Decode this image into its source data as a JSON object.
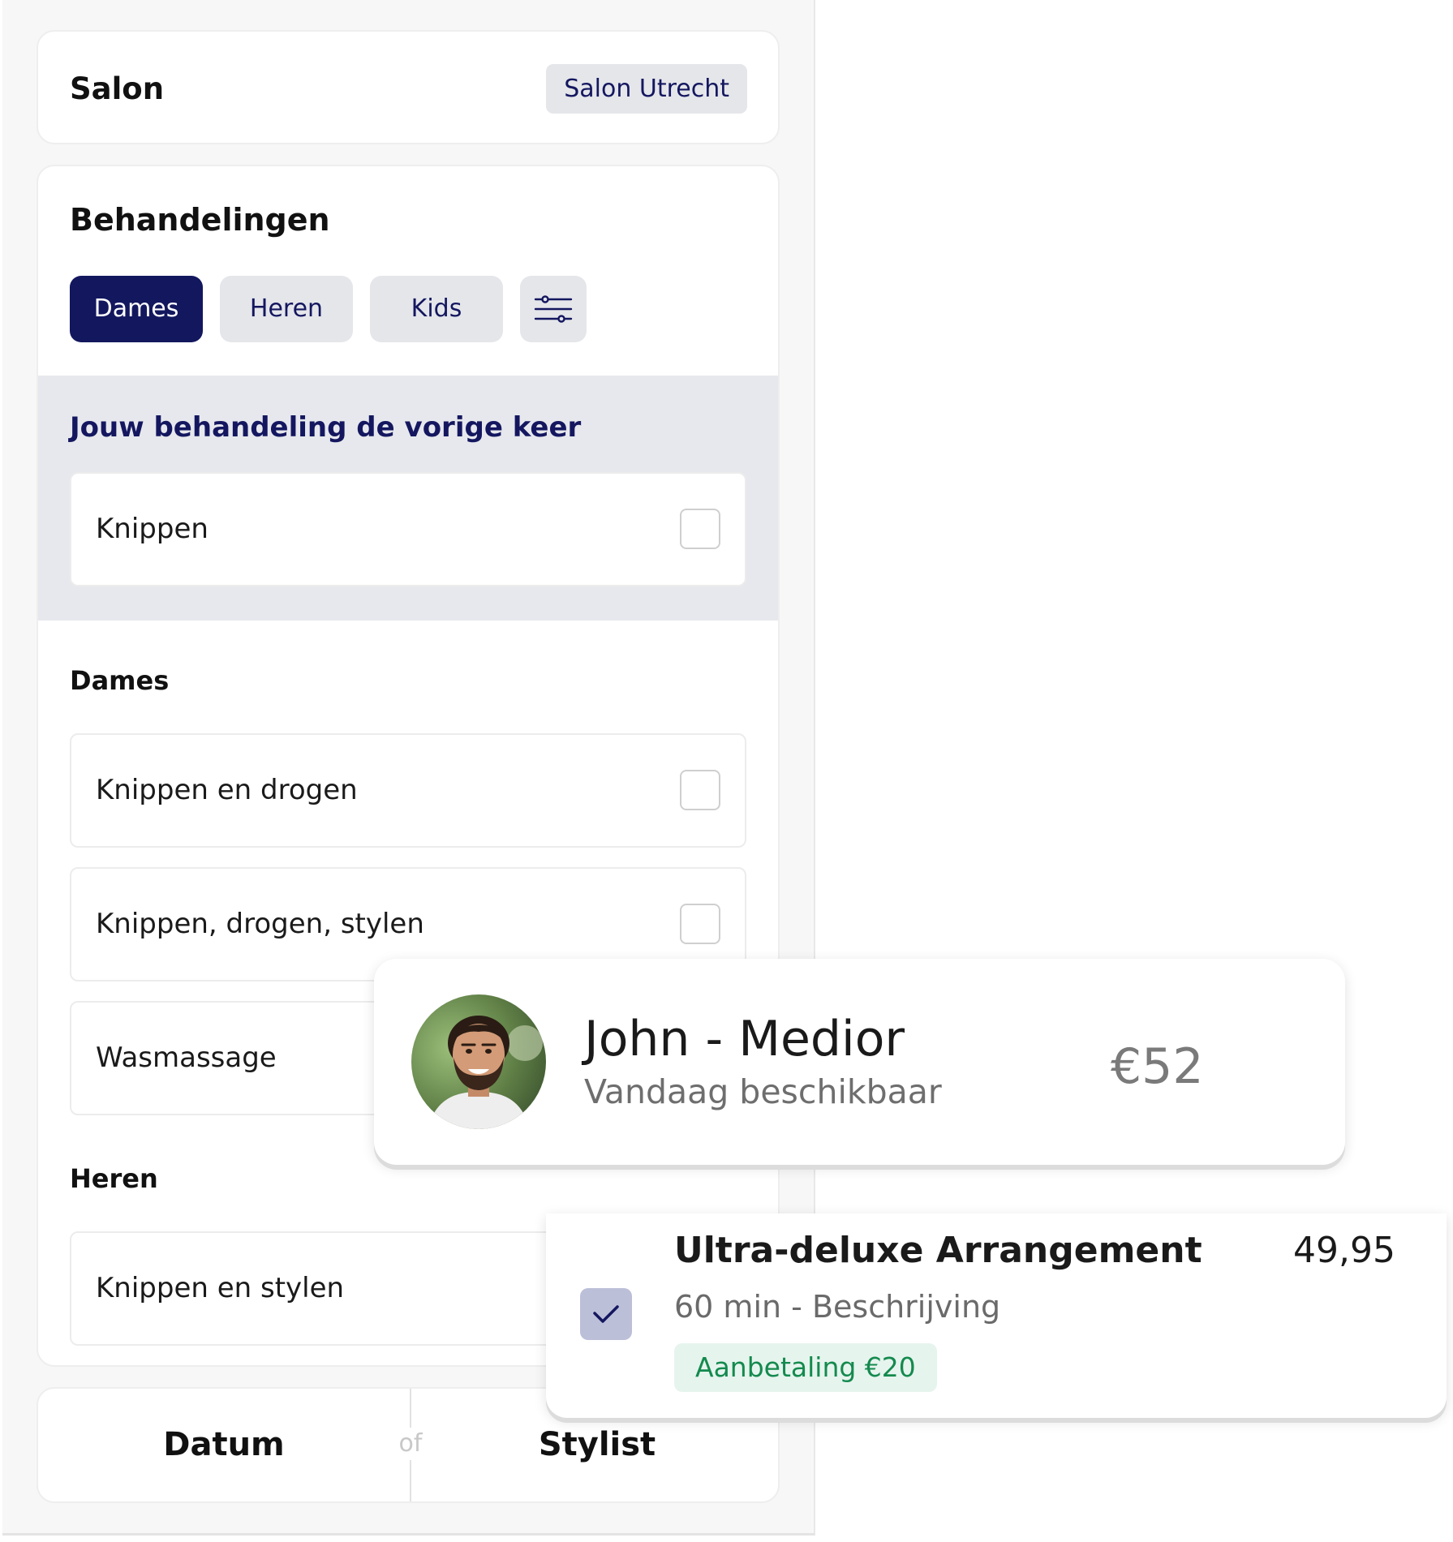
{
  "salon": {
    "title": "Salon",
    "location_badge": "Salon Utrecht"
  },
  "treatments": {
    "title": "Behandelingen",
    "tabs": [
      {
        "label": "Dames",
        "active": true
      },
      {
        "label": "Heren",
        "active": false
      },
      {
        "label": "Kids",
        "active": false
      }
    ],
    "filter_icon": "sliders-icon",
    "previous": {
      "title": "Jouw behandeling de vorige keer",
      "items": [
        {
          "label": "Knippen",
          "checked": false
        }
      ]
    },
    "sections": [
      {
        "title": "Dames",
        "items": [
          {
            "label": "Knippen en drogen",
            "checked": false
          },
          {
            "label": "Knippen, drogen, stylen",
            "checked": false
          },
          {
            "label": "Wasmassage",
            "checked": false
          }
        ]
      },
      {
        "title": "Heren",
        "items": [
          {
            "label": "Knippen en stylen",
            "checked": false
          }
        ]
      }
    ]
  },
  "bottom_nav": {
    "left": "Datum",
    "separator": "of",
    "right": "Stylist"
  },
  "stylist_card": {
    "name": "John - Medior",
    "availability": "Vandaag beschikbaar",
    "price": "€52"
  },
  "treatment_card": {
    "name": "Ultra-deluxe Arrangement",
    "price": "49,95",
    "description": "60 min - Beschrijving",
    "deposit_badge": "Aanbetaling €20",
    "checked": true
  },
  "colors": {
    "brand_navy": "#12175e",
    "chip_bg": "#e5e6ea",
    "deposit_green": "#148a4e",
    "deposit_bg": "#e6f4ee",
    "check_bg": "#bcbfd8"
  }
}
